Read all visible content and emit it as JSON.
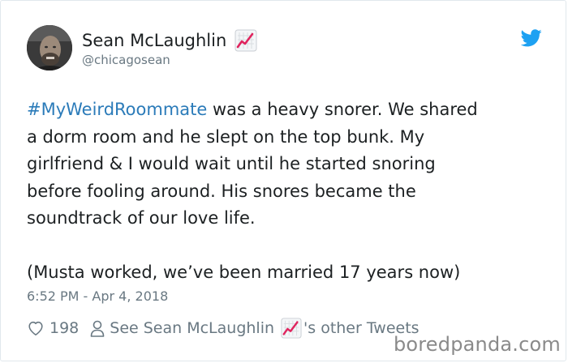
{
  "user": {
    "display_name": "Sean McLaughlin",
    "handle": "@chicagosean",
    "avatar_icon": "avatar-photo",
    "badge_icon": "chart-increasing-emoji"
  },
  "tweet": {
    "hashtag": "#MyWeirdRoommate",
    "body": " was a heavy snorer. We shared\na dorm room and he slept on the top bunk. My\ngirlfriend & I would wait until he started snoring\nbefore fooling around. His snores became the\nsoundtrack of our love life.\n\n(Musta worked, we’ve been married 17 years now)",
    "timestamp": "6:52 PM - Apr 4, 2018"
  },
  "actions": {
    "like_count": "198",
    "see_label": "See Sean McLaughlin",
    "see_suffix": "'s other Tweets",
    "like_icon": "heart-icon",
    "profile_icon": "person-icon"
  },
  "brand": {
    "twitter_icon": "twitter-bird-icon",
    "watermark": "boredpanda.com"
  },
  "colors": {
    "link": "#2b7bb9",
    "muted": "#697882",
    "twitter_blue": "#1da1f2",
    "text": "#1c2022"
  }
}
